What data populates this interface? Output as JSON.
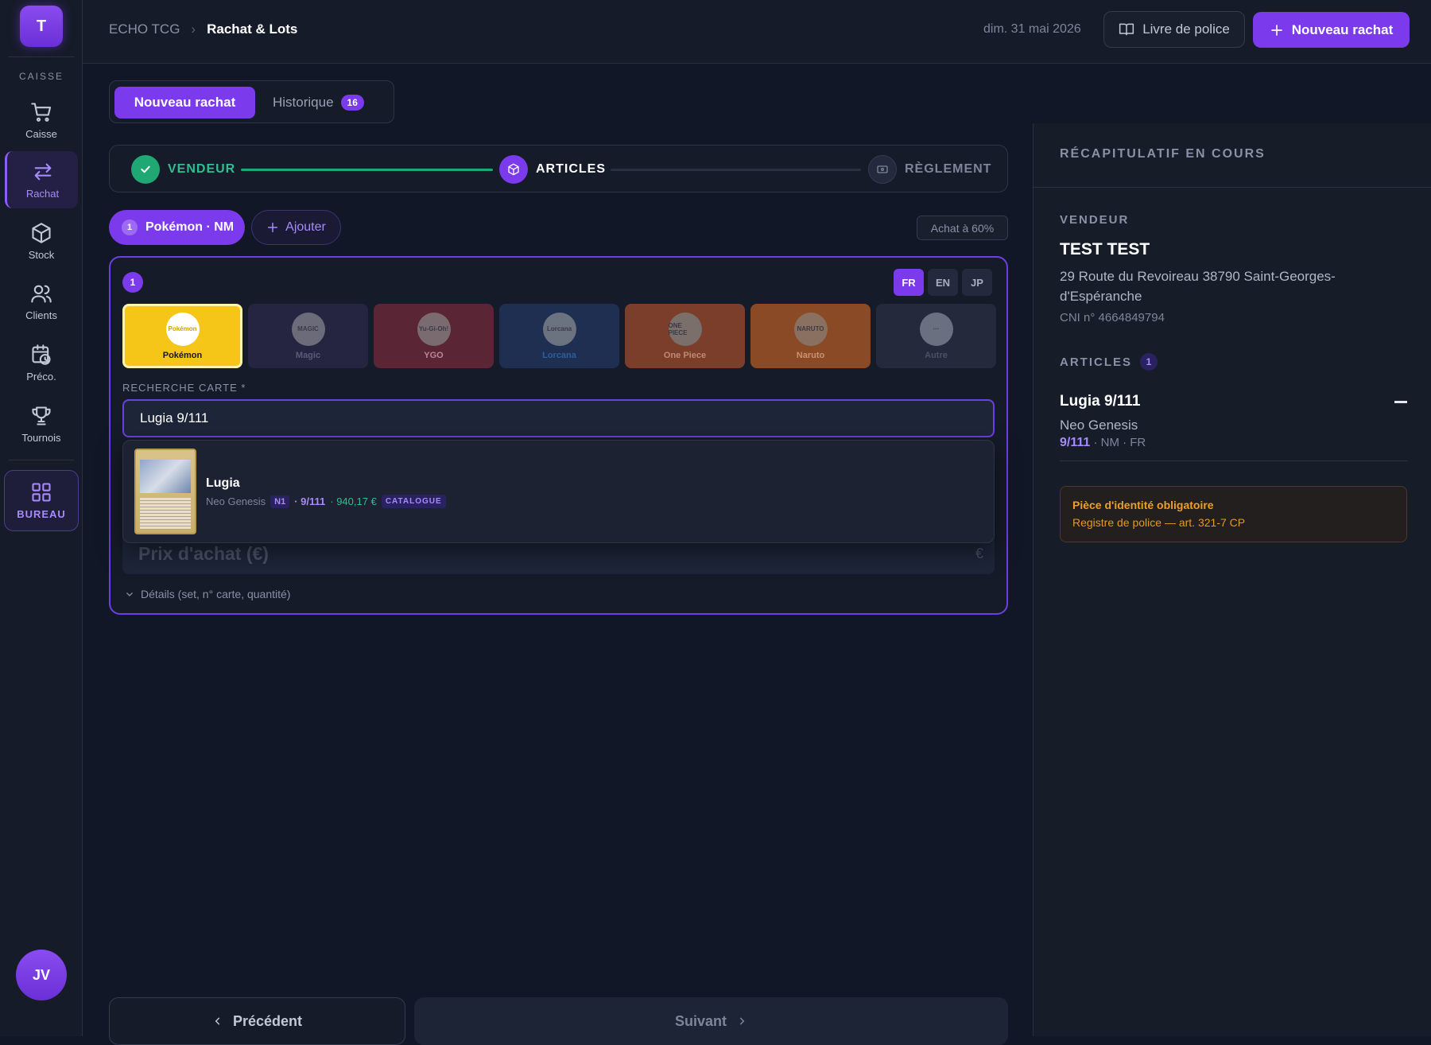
{
  "sidebar": {
    "logo": "T",
    "section": "CAISSE",
    "items": [
      {
        "label": "Caisse",
        "icon": "cart-icon"
      },
      {
        "label": "Rachat",
        "icon": "swap-icon"
      },
      {
        "label": "Stock",
        "icon": "box-icon"
      },
      {
        "label": "Clients",
        "icon": "users-icon"
      },
      {
        "label": "Préco.",
        "icon": "calendar-clock-icon"
      },
      {
        "label": "Tournois",
        "icon": "trophy-icon"
      }
    ],
    "bureau": "BUREAU",
    "avatar": "JV"
  },
  "header": {
    "crumb_root": "ECHO TCG",
    "crumb_sep": "›",
    "crumb_current": "Rachat & Lots",
    "date": "dim. 31 mai 2026",
    "police_label": "Livre de police",
    "new_label": "Nouveau rachat"
  },
  "tabs": {
    "new": "Nouveau rachat",
    "history": "Historique",
    "history_count": "16"
  },
  "stepper": {
    "step1": "VENDEUR",
    "step2": "ARTICLES",
    "step3": "RÈGLEMENT"
  },
  "lot": {
    "chip_num": "1",
    "chip_label": "Pokémon · NM",
    "add_label": "Ajouter",
    "rate": "Achat à 60%"
  },
  "card": {
    "num": "1",
    "langs": [
      "FR",
      "EN",
      "JP"
    ],
    "games": [
      {
        "label": "Pokémon",
        "icon_text": "Pokémon",
        "bg": "#f5c518",
        "fg": "#1a1a1a",
        "ico_bg": "#ffffff"
      },
      {
        "label": "Magic",
        "icon_text": "MAGIC",
        "bg": "#252541",
        "fg": "#5c5a78",
        "ico_bg": "#6b6b7a"
      },
      {
        "label": "YGO",
        "icon_text": "Yu-Gi-Oh!",
        "bg": "#5a2535",
        "fg": "#b88896",
        "ico_bg": "#7a6b70"
      },
      {
        "label": "Lorcana",
        "icon_text": "Lorcana",
        "bg": "#1f2f52",
        "fg": "#2f5d9a",
        "ico_bg": "#6b7280"
      },
      {
        "label": "One Piece",
        "icon_text": "ONE PIECE",
        "bg": "#7a3e2a",
        "fg": "#c08a72",
        "ico_bg": "#7a6f6a"
      },
      {
        "label": "Naruto",
        "icon_text": "NARUTO",
        "bg": "#8a4a25",
        "fg": "#c99270",
        "ico_bg": "#8a7060"
      },
      {
        "label": "Autre",
        "icon_text": "···",
        "bg": "#242a3b",
        "fg": "#4a5166",
        "ico_bg": "#6b7080"
      }
    ],
    "search_label": "RECHERCHE CARTE *",
    "search_value": "Lugia 9/111",
    "price_placeholder": "Prix d'achat (€)",
    "price_unit": "€",
    "details": "Détails (set, n° carte, quantité)"
  },
  "result": {
    "name": "Lugia",
    "set": "Neo Genesis",
    "tag": "N1",
    "number": "· 9/111",
    "price": "· 940,17 €",
    "source": "CATALOGUE"
  },
  "footer": {
    "prev": "Précédent",
    "next": "Suivant"
  },
  "summary": {
    "title": "RÉCAPITULATIF EN COURS",
    "vendor_h": "VENDEUR",
    "vendor_name": "TEST TEST",
    "vendor_addr": "29 Route du Revoireau 38790 Saint-Georges-d'Espéranche",
    "vendor_cni": "CNI n° 4664849794",
    "articles_h": "ARTICLES",
    "articles_count": "1",
    "item_name": "Lugia 9/111",
    "item_set": "Neo Genesis",
    "item_num": "9/111",
    "item_cond": "· NM · FR",
    "warn_title": "Pièce d'identité obligatoire",
    "warn_sub": "Registre de police — art. 321-7 CP"
  }
}
